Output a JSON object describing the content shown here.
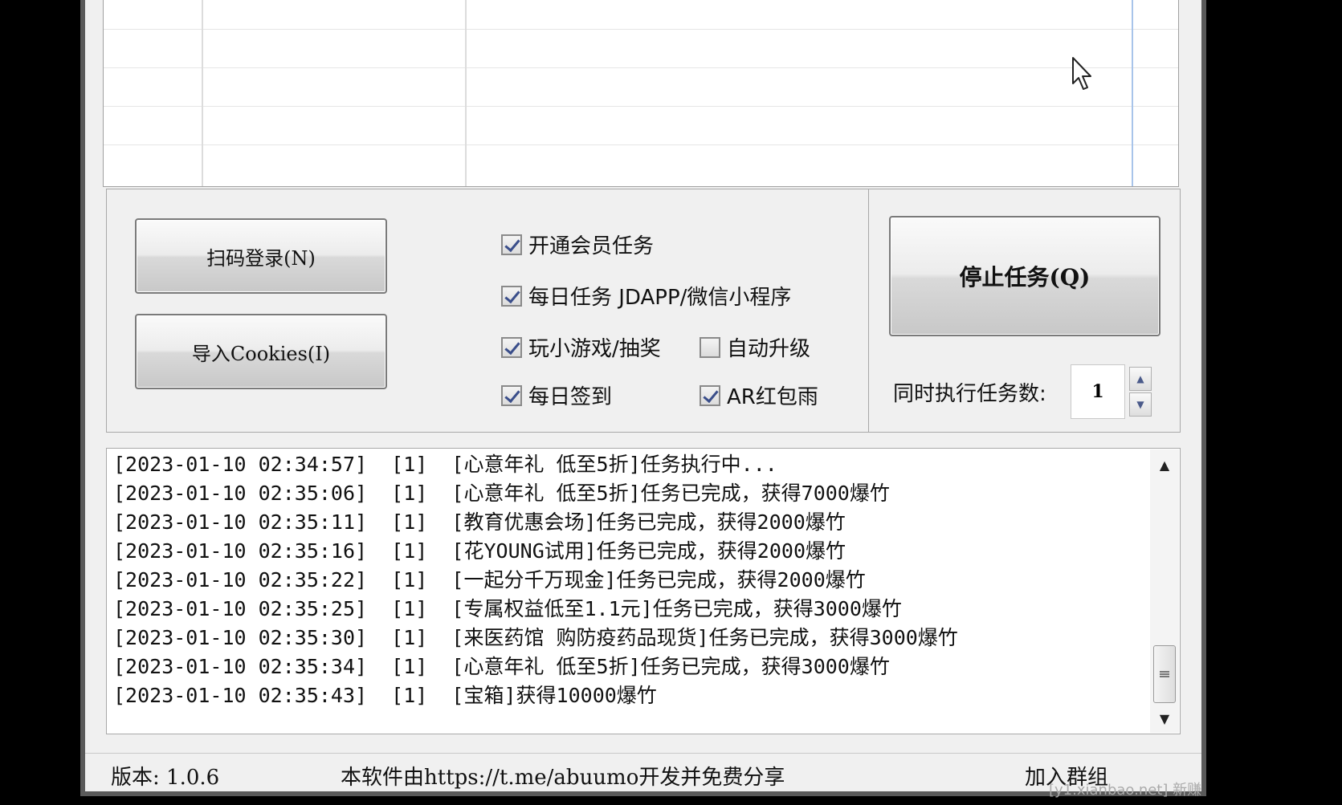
{
  "buttons": {
    "qr_login": "扫码登录(N)",
    "import_cookies": "导入Cookies(I)",
    "stop_task": "停止任务(Q)"
  },
  "options": [
    {
      "label": "开通会员任务",
      "checked": true
    },
    {
      "label": "每日任务 JDAPP/微信小程序",
      "checked": true
    },
    {
      "label": "玩小游戏/抽奖",
      "checked": true
    },
    {
      "label": "自动升级",
      "checked": false
    },
    {
      "label": "每日签到",
      "checked": true
    },
    {
      "label": "AR红包雨",
      "checked": true
    }
  ],
  "concurrency": {
    "label": "同时执行任务数:",
    "value": "1"
  },
  "log": [
    "[2023-01-10 02:34:57]  [1]  [心意年礼 低至5折]任务执行中...",
    "[2023-01-10 02:35:06]  [1]  [心意年礼 低至5折]任务已完成，获得7000爆竹",
    "[2023-01-10 02:35:11]  [1]  [教育优惠会场]任务已完成，获得2000爆竹",
    "[2023-01-10 02:35:16]  [1]  [花YOUNG试用]任务已完成，获得2000爆竹",
    "[2023-01-10 02:35:22]  [1]  [一起分千万现金]任务已完成，获得2000爆竹",
    "[2023-01-10 02:35:25]  [1]  [专属权益低至1.1元]任务已完成，获得3000爆竹",
    "[2023-01-10 02:35:30]  [1]  [来医药馆 购防疫药品现货]任务已完成，获得3000爆竹",
    "[2023-01-10 02:35:34]  [1]  [心意年礼 低至5折]任务已完成，获得3000爆竹",
    "[2023-01-10 02:35:43]  [1]  [宝箱]获得10000爆竹"
  ],
  "status": {
    "version": "版本: 1.0.6",
    "share": "本软件由https://t.me/abuumo开发并免费分享",
    "join_group": "加入群组"
  },
  "watermark": "[y1.xianbao.net] 新赚",
  "colors": {
    "window_bg": "#f0f0f0",
    "check_mark": "#3a4e8a",
    "grid_blue_line": "#a8c4ea"
  },
  "icons": {
    "cursor": "arrow-cursor-icon",
    "scroll_up": "triangle-up-icon",
    "scroll_down": "triangle-down-icon",
    "grip": "scroll-grip-icon"
  }
}
